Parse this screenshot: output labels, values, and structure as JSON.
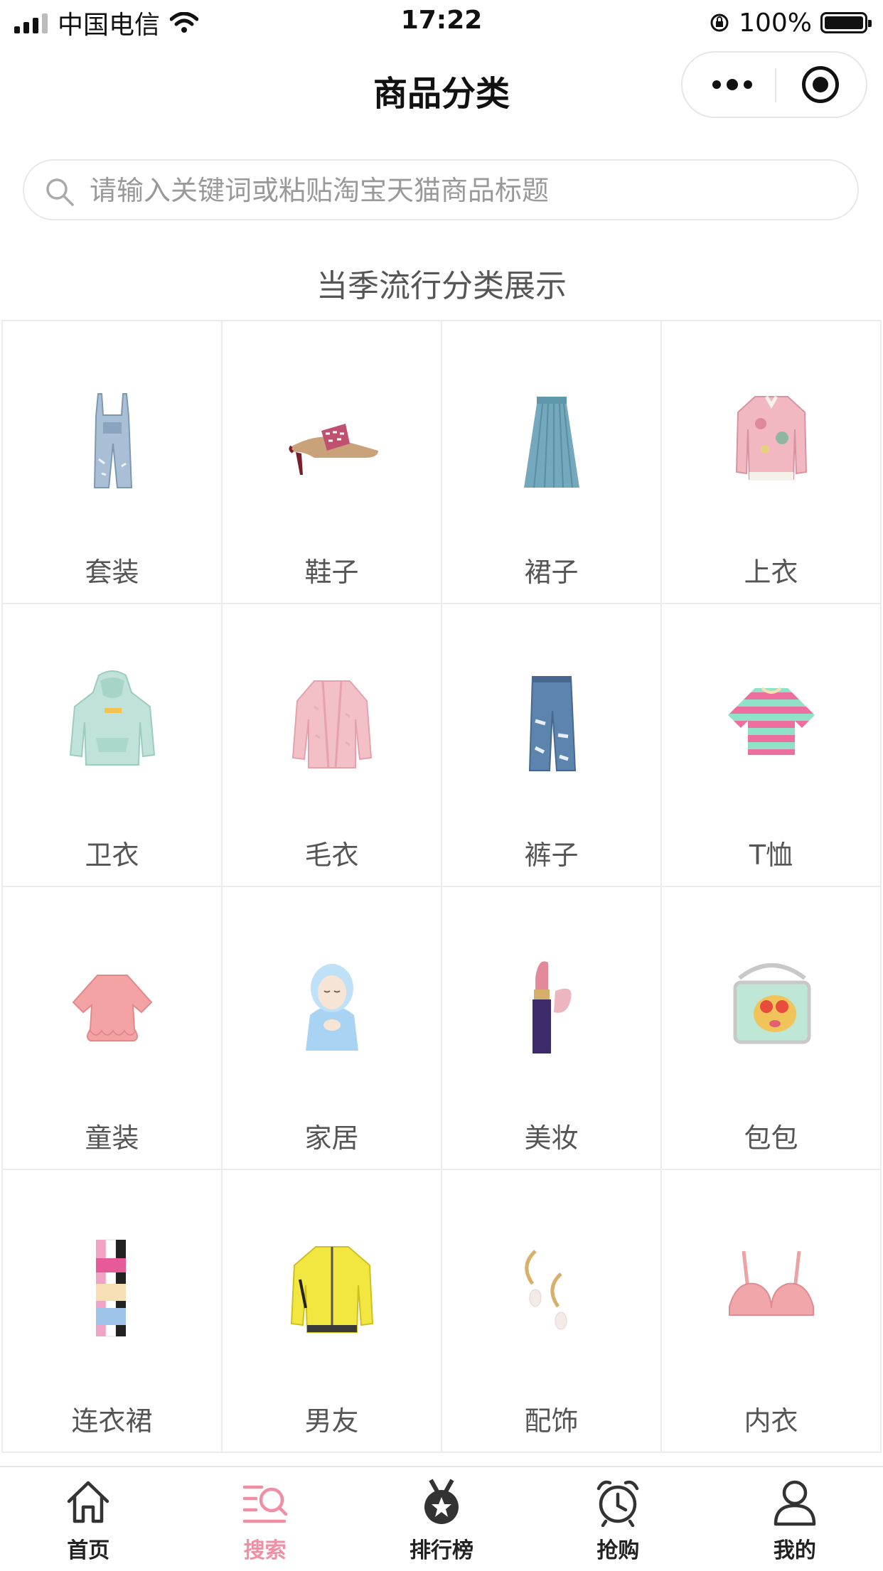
{
  "status_bar": {
    "carrier": "中国电信",
    "time": "17:22",
    "battery": "100%"
  },
  "nav": {
    "title": "商品分类"
  },
  "search": {
    "placeholder": "请输入关键词或粘贴淘宝天猫商品标题"
  },
  "section_title": "当季流行分类展示",
  "categories": [
    {
      "label": "套装",
      "icon": "overalls-image"
    },
    {
      "label": "鞋子",
      "icon": "shoe-image"
    },
    {
      "label": "裙子",
      "icon": "skirt-image"
    },
    {
      "label": "上衣",
      "icon": "jacket-image"
    },
    {
      "label": "卫衣",
      "icon": "hoodie-image"
    },
    {
      "label": "毛衣",
      "icon": "sweater-image"
    },
    {
      "label": "裤子",
      "icon": "jeans-image"
    },
    {
      "label": "T恤",
      "icon": "tshirt-image"
    },
    {
      "label": "童装",
      "icon": "kids-blouse-image"
    },
    {
      "label": "家居",
      "icon": "figurine-image"
    },
    {
      "label": "美妆",
      "icon": "lipstick-image"
    },
    {
      "label": "包包",
      "icon": "bag-image"
    },
    {
      "label": "连衣裙",
      "icon": "dress-image"
    },
    {
      "label": "男友",
      "icon": "menswear-jacket-image"
    },
    {
      "label": "配饰",
      "icon": "earrings-image"
    },
    {
      "label": "内衣",
      "icon": "bra-image"
    }
  ],
  "tabbar": [
    {
      "label": "首页",
      "icon": "home-icon",
      "active": false
    },
    {
      "label": "搜索",
      "icon": "search-list-icon",
      "active": true
    },
    {
      "label": "排行榜",
      "icon": "medal-icon",
      "active": false
    },
    {
      "label": "抢购",
      "icon": "alarm-clock-icon",
      "active": false
    },
    {
      "label": "我的",
      "icon": "user-icon",
      "active": false
    }
  ],
  "colors": {
    "accent": "#f08ea4",
    "text": "#333333",
    "border": "#ececec"
  }
}
